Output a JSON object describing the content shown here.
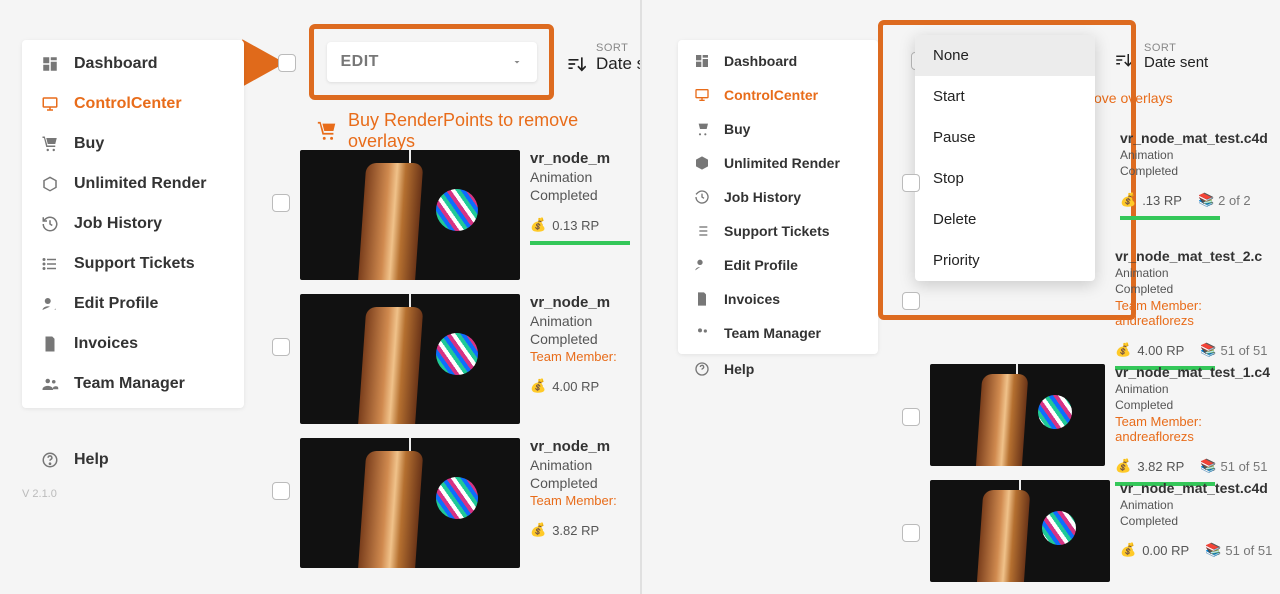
{
  "nav": {
    "items": [
      {
        "id": "dashboard",
        "label": "Dashboard"
      },
      {
        "id": "controlcenter",
        "label": "ControlCenter"
      },
      {
        "id": "buy",
        "label": "Buy"
      },
      {
        "id": "unlimited",
        "label": "Unlimited Render"
      },
      {
        "id": "jobhistory",
        "label": "Job History"
      },
      {
        "id": "tickets",
        "label": "Support Tickets"
      },
      {
        "id": "editprofile",
        "label": "Edit Profile"
      },
      {
        "id": "invoices",
        "label": "Invoices"
      },
      {
        "id": "teammanager",
        "label": "Team Manager"
      }
    ],
    "help": "Help",
    "version": "V 2.1.0"
  },
  "editDropdown": {
    "label": "EDIT",
    "options": [
      "None",
      "Start",
      "Pause",
      "Stop",
      "Delete",
      "Priority"
    ],
    "selected": "None"
  },
  "sort": {
    "label": "SORT",
    "value_left": "Date s",
    "value_right": "Date sent"
  },
  "buyLink": {
    "left": "Buy RenderPoints to remove overlays",
    "right": "ove overlays"
  },
  "leftJobs": [
    {
      "name": "vr_node_m",
      "type": "Animation",
      "status": "Completed",
      "rp": "0.13 RP"
    },
    {
      "name": "vr_node_m",
      "type": "Animation",
      "status": "Completed",
      "member": "Team Member:",
      "rp": "4.00 RP"
    },
    {
      "name": "vr_node_m",
      "type": "Animation",
      "status": "Completed",
      "member": "Team Member:",
      "rp": "3.82 RP"
    }
  ],
  "rightJobs": [
    {
      "name": "vr_node_mat_test.c4d",
      "type": "Animation",
      "status": "Completed",
      "rp": ".13 RP",
      "frames": "2 of 2"
    },
    {
      "name": "vr_node_mat_test_2.c",
      "type": "Animation",
      "status": "Completed",
      "member": "Team Member: andreaflorezs",
      "rp": "4.00 RP",
      "frames": "51 of 51"
    },
    {
      "name": "vr_node_mat_test_1.c4",
      "type": "Animation",
      "status": "Completed",
      "member": "Team Member: andreaflorezs",
      "rp": "3.82 RP",
      "frames": "51 of 51"
    },
    {
      "name": "vr_node_mat_test.c4d",
      "type": "Animation",
      "status": "Completed",
      "rp": "0.00 RP",
      "frames": "51 of 51"
    }
  ]
}
